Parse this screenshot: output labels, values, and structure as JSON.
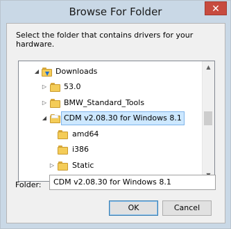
{
  "window": {
    "title": "Browse For Folder",
    "close_glyph": "✕"
  },
  "instruction": "Select the folder that contains drivers for your hardware.",
  "tree": {
    "items": [
      {
        "label": "Downloads",
        "arrow": "◢",
        "icon": "downloads-folder-icon"
      },
      {
        "label": "53.0",
        "arrow": "▷",
        "icon": "folder-icon"
      },
      {
        "label": "BMW_Standard_Tools",
        "arrow": "▷",
        "icon": "folder-icon"
      },
      {
        "label": "CDM v2.08.30 for Windows 8.1",
        "arrow": "◢",
        "icon": "folder-icon",
        "selected": true
      },
      {
        "label": "amd64",
        "arrow": "",
        "icon": "folder-icon"
      },
      {
        "label": "i386",
        "arrow": "",
        "icon": "folder-icon"
      },
      {
        "label": "Static",
        "arrow": "▷",
        "icon": "folder-icon"
      }
    ],
    "scroll_up": "▲",
    "scroll_down": "▼"
  },
  "folder_field": {
    "label": "Folder:",
    "value": "CDM v2.08.30 for Windows 8.1"
  },
  "buttons": {
    "ok": "OK",
    "cancel": "Cancel"
  }
}
